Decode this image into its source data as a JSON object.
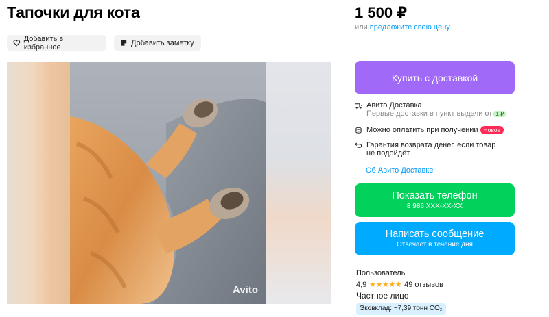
{
  "listing": {
    "title": "Тапочки для кота",
    "add_favorite": "Добавить в избранное",
    "add_note": "Добавить заметку",
    "watermark": "Avito"
  },
  "price": {
    "value": "1 500 ₽",
    "offer_prefix": "или",
    "offer_link": "предложите свою цену"
  },
  "delivery": {
    "buy_button": "Купить с доставкой",
    "service_title": "Авито Доставка",
    "first_deliveries": "Первые доставки в пункт выдачи от",
    "min_price_badge": "1 ₽",
    "pay_on_receipt": "Можно оплатить при получении",
    "new_badge": "Новое",
    "guarantee_line1": "Гарантия возврата денег, если товар",
    "guarantee_line2": "не подойдёт",
    "about_link": "Об Авито Доставке"
  },
  "contact": {
    "phone_button": "Показать телефон",
    "phone_masked": "8 986 XXX-XX-XX",
    "message_button": "Написать сообщение",
    "message_sub": "Отвечает в течение дня"
  },
  "seller": {
    "type": "Пользователь",
    "rating": "4,9",
    "stars": "★★★★★",
    "reviews": "49 отзывов",
    "kind": "Частное лицо",
    "eco": "Эковклад: ~7,39 тонн CO₂"
  },
  "colors": {
    "buy": "#a169f7",
    "phone": "#02d15c",
    "message": "#00aaff",
    "link": "#0099f7",
    "new_badge": "#ff2a55"
  },
  "icons": [
    "heart-icon",
    "note-icon",
    "truck-icon",
    "coins-icon",
    "return-icon"
  ]
}
